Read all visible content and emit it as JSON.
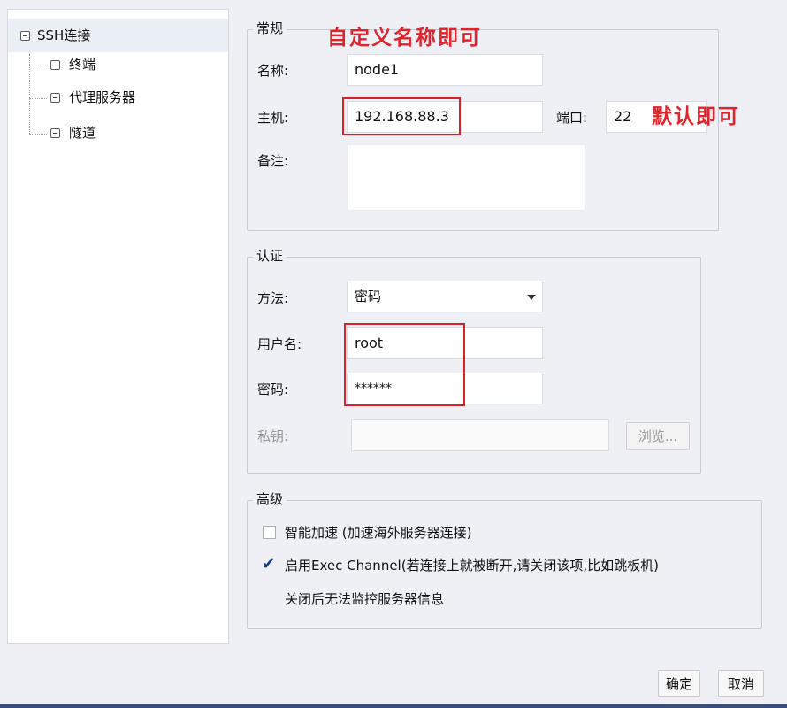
{
  "tree": {
    "root": "SSH连接",
    "children": [
      "终端",
      "代理服务器",
      "隧道"
    ]
  },
  "general": {
    "legend": "常规",
    "name_label": "名称:",
    "name_value": "node1",
    "host_label": "主机:",
    "host_value": "192.168.88.3",
    "port_label": "端口:",
    "port_value": "22",
    "note_label": "备注:",
    "note_value": ""
  },
  "auth": {
    "legend": "认证",
    "method_label": "方法:",
    "method_value": "密码",
    "username_label": "用户名:",
    "username_value": "root",
    "password_label": "密码:",
    "password_value": "******",
    "privkey_label": "私钥:",
    "privkey_value": "",
    "browse_label": "浏览..."
  },
  "advanced": {
    "legend": "高级",
    "smart_accel_label": "智能加速 (加速海外服务器连接)",
    "smart_accel_checked": false,
    "exec_channel_label": "启用Exec Channel(若连接上就被断开,请关闭该项,比如跳板机)",
    "exec_channel_checked": true,
    "exec_channel_note": "关闭后无法监控服务器信息"
  },
  "annotations": {
    "name_hint": "自定义名称即可",
    "port_hint": "默认即可"
  },
  "footer": {
    "ok_label": "确定",
    "cancel_label": "取消"
  },
  "colors": {
    "annotation_red": "#e0242c",
    "checkmark_blue": "#1d3d7a"
  }
}
